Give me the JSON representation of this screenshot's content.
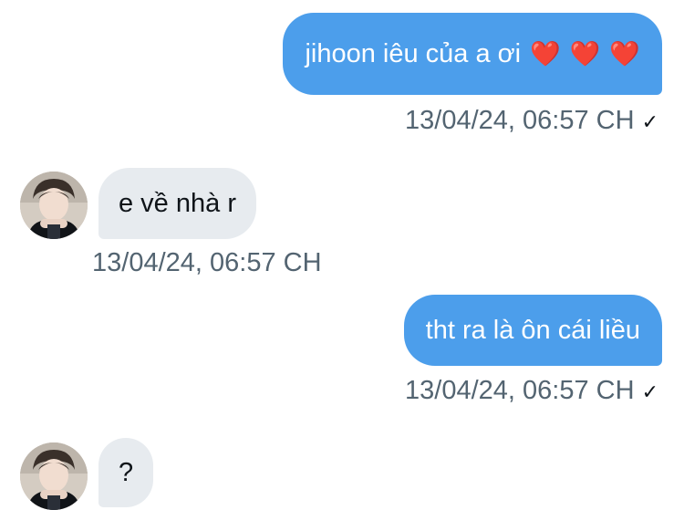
{
  "messages": [
    {
      "direction": "outgoing",
      "text": "jihoon iêu của a ơi",
      "emoji": [
        "❤️",
        "❤️",
        "❤️"
      ],
      "timestamp": "13/04/24, 06:57 CH",
      "status_icon": "check-icon"
    },
    {
      "direction": "incoming",
      "text": "e về nhà r",
      "timestamp": "13/04/24, 06:57 CH",
      "avatar_icon": "avatar-photo"
    },
    {
      "direction": "outgoing",
      "text": "tht ra là ôn cái liều",
      "timestamp": "13/04/24, 06:57 CH",
      "status_icon": "check-icon"
    },
    {
      "direction": "incoming",
      "text": "?",
      "avatar_icon": "avatar-photo"
    }
  ],
  "colors": {
    "outgoing_bubble": "#4c9eeb",
    "incoming_bubble": "#e7ebef",
    "timestamp_text": "#536471",
    "heart": "#e0202f"
  },
  "icons": {
    "check": "✓"
  }
}
